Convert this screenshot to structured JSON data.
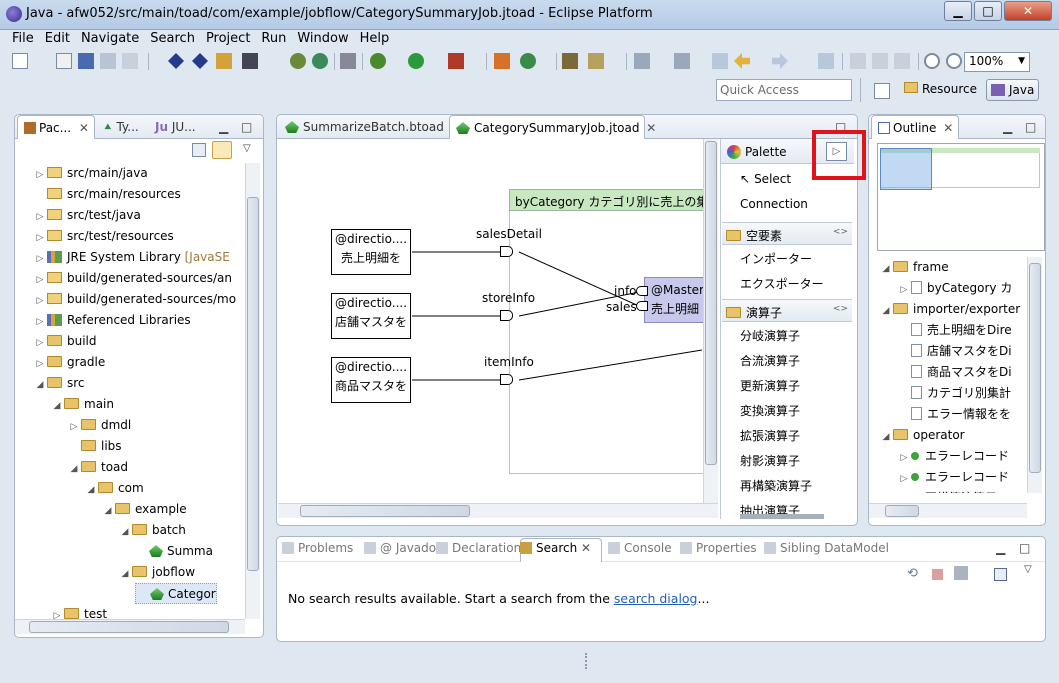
{
  "window": {
    "title": "Java - afw052/src/main/toad/com/example/jobflow/CategorySummaryJob.jtoad - Eclipse Platform"
  },
  "menu": [
    "File",
    "Edit",
    "Navigate",
    "Search",
    "Project",
    "Run",
    "Window",
    "Help"
  ],
  "toolbar": {
    "zoom": "100%",
    "quick_access_placeholder": "Quick Access"
  },
  "perspectives": {
    "resource": "Resource",
    "java": "Java"
  },
  "package_explorer": {
    "tabs": [
      "Pac...",
      "Ty...",
      "JU..."
    ],
    "items": [
      {
        "label": "src/main/java",
        "indent": 1,
        "arrow": "▷",
        "icon": "pkg"
      },
      {
        "label": "src/main/resources",
        "indent": 1,
        "arrow": "",
        "icon": "pkg"
      },
      {
        "label": "src/test/java",
        "indent": 1,
        "arrow": "▷",
        "icon": "pkg"
      },
      {
        "label": "src/test/resources",
        "indent": 1,
        "arrow": "▷",
        "icon": "pkg"
      },
      {
        "label": "JRE System Library",
        "suffix": " [JavaSE",
        "indent": 1,
        "arrow": "▷",
        "icon": "lib"
      },
      {
        "label": "build/generated-sources/an",
        "indent": 1,
        "arrow": "▷",
        "icon": "pkg"
      },
      {
        "label": "build/generated-sources/mo",
        "indent": 1,
        "arrow": "▷",
        "icon": "pkg"
      },
      {
        "label": "Referenced Libraries",
        "indent": 1,
        "arrow": "▷",
        "icon": "lib"
      },
      {
        "label": "build",
        "indent": 1,
        "arrow": "▷",
        "icon": "fld"
      },
      {
        "label": "gradle",
        "indent": 1,
        "arrow": "▷",
        "icon": "fld"
      },
      {
        "label": "src",
        "indent": 1,
        "arrow": "◢",
        "icon": "fld"
      },
      {
        "label": "main",
        "indent": 2,
        "arrow": "◢",
        "icon": "fld"
      },
      {
        "label": "dmdl",
        "indent": 3,
        "arrow": "▷",
        "icon": "fld"
      },
      {
        "label": "libs",
        "indent": 3,
        "arrow": "",
        "icon": "fld"
      },
      {
        "label": "toad",
        "indent": 3,
        "arrow": "◢",
        "icon": "fld"
      },
      {
        "label": "com",
        "indent": 4,
        "arrow": "◢",
        "icon": "fld"
      },
      {
        "label": "example",
        "indent": 5,
        "arrow": "◢",
        "icon": "fld"
      },
      {
        "label": "batch",
        "indent": 6,
        "arrow": "◢",
        "icon": "fld"
      },
      {
        "label": "Summa",
        "indent": 7,
        "arrow": "",
        "icon": "ghost"
      },
      {
        "label": "jobflow",
        "indent": 6,
        "arrow": "◢",
        "icon": "fld"
      },
      {
        "label": "Categor",
        "indent": 7,
        "arrow": "",
        "icon": "ghost"
      },
      {
        "label": "test",
        "indent": 2,
        "arrow": "▷",
        "icon": "fld"
      }
    ]
  },
  "editor": {
    "tabs": [
      "SummarizeBatch.btoad",
      "CategorySummaryJob.jtoad"
    ],
    "frame_title": "byCategory カテゴリ別に売上の集",
    "inputs": [
      {
        "line1": "@directio....",
        "line2": "売上明細を",
        "port": "salesDetail"
      },
      {
        "line1": "@directio....",
        "line2": "店舗マスタを",
        "port": "storeInfo"
      },
      {
        "line1": "@directio....",
        "line2": "商品マスタを",
        "port": "itemInfo"
      }
    ],
    "operator": {
      "line1": "@Master",
      "line2": "売上明細",
      "port_info": "info",
      "port_sales": "sales"
    }
  },
  "palette": {
    "title": "Palette",
    "tools": [
      "Select",
      "Connection"
    ],
    "sections": [
      {
        "label": "空要素",
        "items": [
          "インポーター",
          "エクスポーター"
        ]
      },
      {
        "label": "演算子",
        "items": [
          "分岐演算子",
          "合流演算子",
          "更新演算子",
          "変換演算子",
          "拡張演算子",
          "射影演算子",
          "再構築演算子",
          "抽出演算子"
        ]
      }
    ]
  },
  "outline": {
    "title": "Outline",
    "items": [
      {
        "label": "frame",
        "indent": 0,
        "icon": "fld",
        "arrow": "◢"
      },
      {
        "label": "byCategory カ",
        "indent": 1,
        "icon": "doc",
        "arrow": "▷"
      },
      {
        "label": "importer/exporter",
        "indent": 0,
        "icon": "fld",
        "arrow": "◢"
      },
      {
        "label": "売上明細をDire",
        "indent": 1,
        "icon": "doc",
        "arrow": ""
      },
      {
        "label": "店舗マスタをDi",
        "indent": 1,
        "icon": "doc",
        "arrow": ""
      },
      {
        "label": "商品マスタをDi",
        "indent": 1,
        "icon": "doc",
        "arrow": ""
      },
      {
        "label": "カテゴリ別集計",
        "indent": 1,
        "icon": "doc",
        "arrow": ""
      },
      {
        "label": "エラー情報をを",
        "indent": 1,
        "icon": "doc",
        "arrow": ""
      },
      {
        "label": "operator",
        "indent": 0,
        "icon": "fld",
        "arrow": "◢"
      },
      {
        "label": "エラーレコード",
        "indent": 1,
        "icon": "dot",
        "arrow": "▷"
      },
      {
        "label": "エラーレコード",
        "indent": 1,
        "icon": "dot",
        "arrow": "▷"
      },
      {
        "label": "再構築演算子 <",
        "indent": 1,
        "icon": "dot",
        "arrow": "▷"
      }
    ]
  },
  "bottom_panel": {
    "tabs": [
      "Problems",
      "@ Javadoc",
      "Declaration",
      "Search",
      "Console",
      "Properties",
      "Sibling DataModel"
    ],
    "message": "No search results available. Start a search from the ",
    "link": "search dialog",
    "ellipsis": "..."
  },
  "colors": {
    "highlight": "#e0121a",
    "frame_header": "#c7e8c0",
    "operator_fill": "#c8c8ec",
    "link": "#1f5fb6"
  }
}
